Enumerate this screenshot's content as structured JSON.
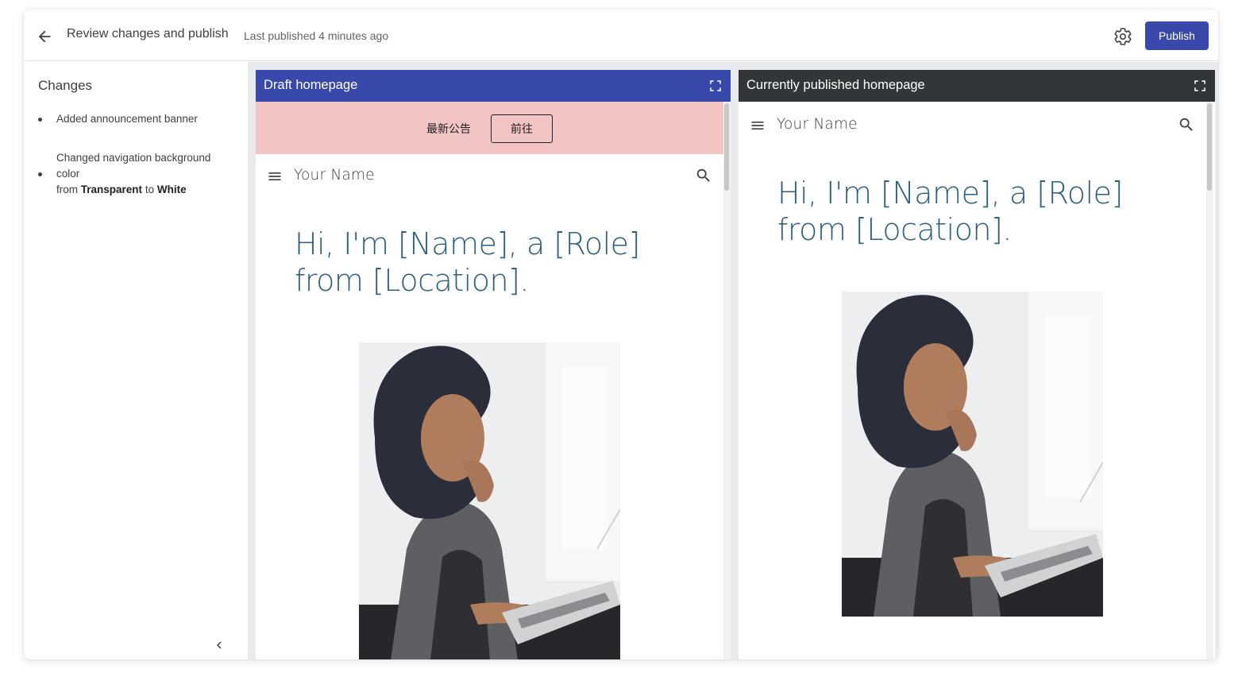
{
  "header": {
    "title": "Review changes and publish",
    "subtitle": "Last published 4 minutes ago",
    "publish_label": "Publish"
  },
  "sidebar": {
    "title": "Changes",
    "change_1": "Added announcement banner",
    "change_2_prefix": "Changed navigation background color",
    "change_2_from": "from",
    "change_2_old": "Transparent",
    "change_2_to": "to",
    "change_2_new": "White"
  },
  "draft": {
    "title": "Draft homepage",
    "banner_text": "最新公告",
    "banner_button": "前往",
    "site_name": "Your Name",
    "hero": "Hi, I'm [Name], a [Role] from [Location]."
  },
  "current": {
    "title": "Currently published homepage",
    "site_name": "Your Name",
    "hero": "Hi, I'm [Name], a [Role] from [Location]."
  },
  "colors": {
    "accent": "#3949ab",
    "dark_bar": "#323639",
    "banner": "#f2c4c4",
    "hero_text": "#2b5f7f"
  },
  "icons": {
    "back": "arrow-left-icon",
    "settings": "gear-icon",
    "fullscreen": "fullscreen-icon",
    "menu": "hamburger-menu-icon",
    "search": "search-icon",
    "collapse": "chevron-left-icon"
  }
}
